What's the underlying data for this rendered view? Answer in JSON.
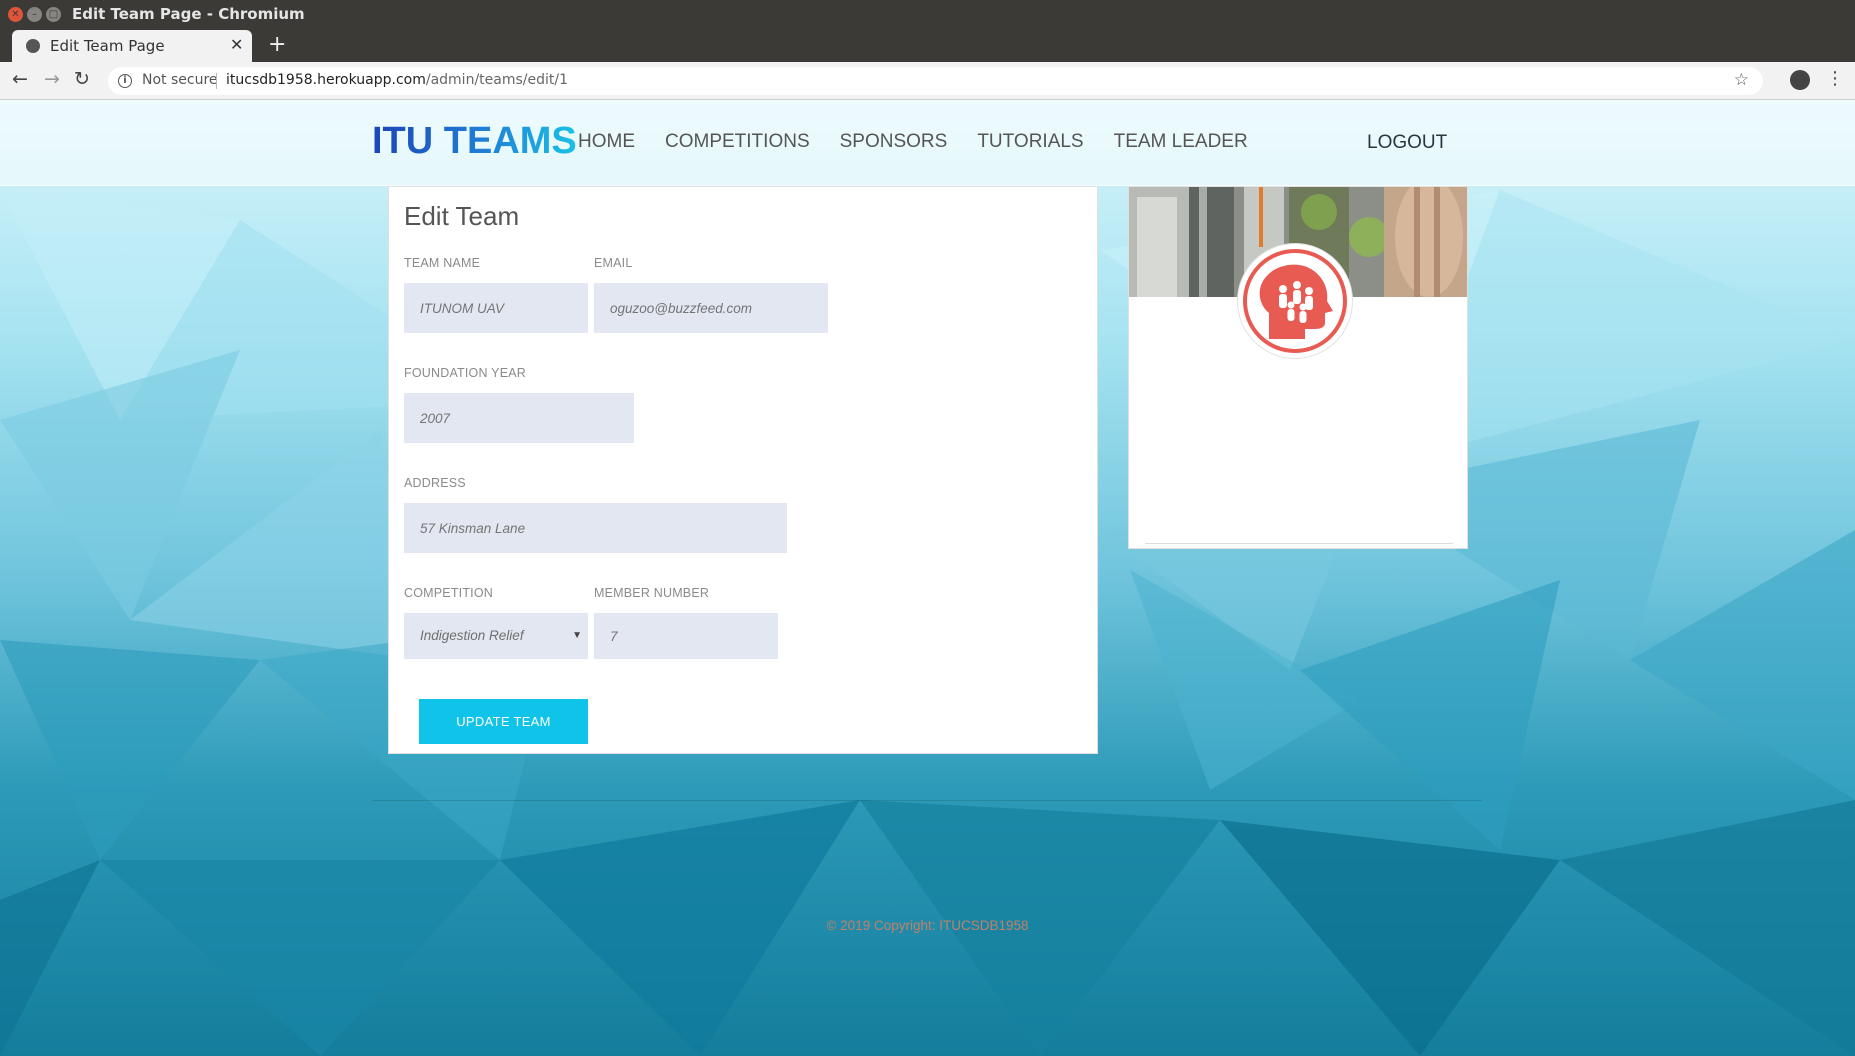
{
  "window": {
    "title": "Edit Team Page - Chromium"
  },
  "browser": {
    "tab_title": "Edit Team Page",
    "security_label": "Not secure",
    "url_host": "itucsdb1958.herokuapp.com",
    "url_path": "/admin/teams/edit/1"
  },
  "nav": {
    "brand": "ITU TEAMS",
    "links": [
      "HOME",
      "COMPETITIONS",
      "SPONSORS",
      "TUTORIALS",
      "TEAM LEADER"
    ],
    "logout": "LOGOUT"
  },
  "form": {
    "title": "Edit Team",
    "team_name": {
      "label": "TEAM NAME",
      "placeholder": "ITUNOM UAV"
    },
    "email": {
      "label": "EMAIL",
      "placeholder": "oguzoo@buzzfeed.com"
    },
    "foundation_year": {
      "label": "FOUNDATION YEAR",
      "placeholder": "2007"
    },
    "address": {
      "label": "ADDRESS",
      "placeholder": "57 Kinsman Lane"
    },
    "competition": {
      "label": "COMPETITION",
      "selected": "Indigestion Relief"
    },
    "member_number": {
      "label": "MEMBER NUMBER",
      "placeholder": "7"
    },
    "submit_label": "UPDATE TEAM"
  },
  "footer": {
    "copyright": "© 2019 Copyright: ITUCSDB1958"
  },
  "colors": {
    "accent": "#0fc4e8",
    "brand_start": "#1c44b8",
    "brand_end": "#19c1e6",
    "avatar_icon": "#e85b52"
  },
  "icons": {
    "avatar": "team-head-icon",
    "security": "info-icon",
    "bookmark": "star-icon"
  }
}
